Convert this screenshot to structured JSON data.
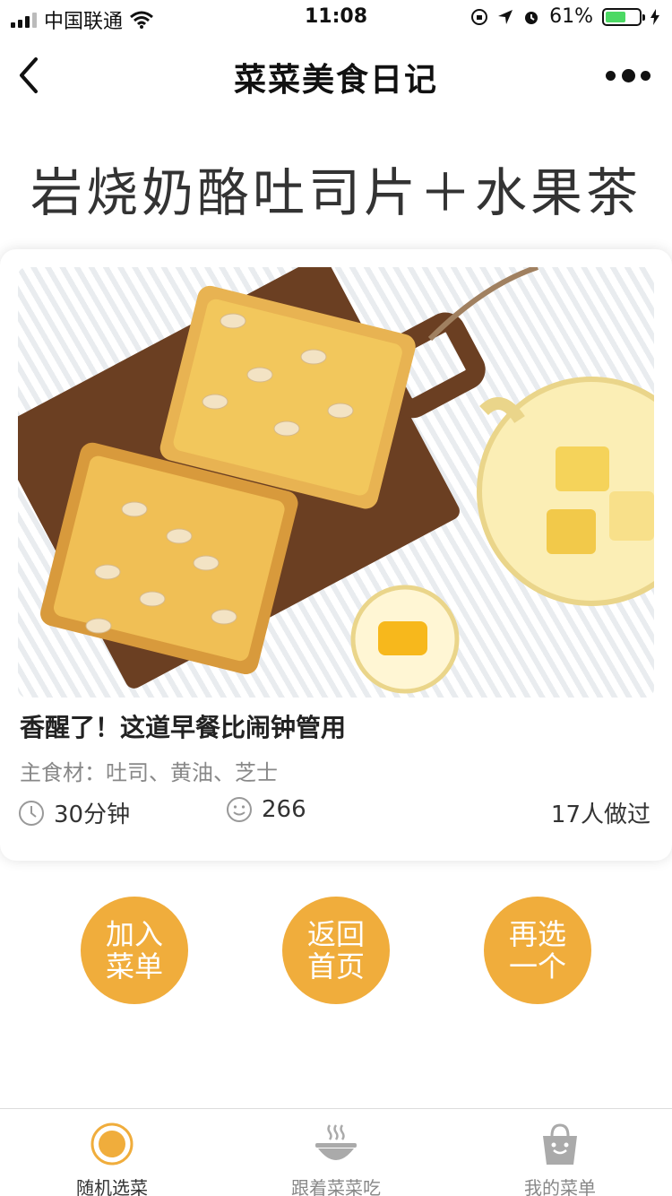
{
  "status_bar": {
    "carrier": "中国联通",
    "time": "11:08",
    "battery": "61%",
    "battery_level": 0.61
  },
  "nav": {
    "title": "菜菜美食日记"
  },
  "dish": {
    "title": "岩烧奶酪吐司片＋水果茶"
  },
  "card": {
    "headline": "香醒了！这道早餐比闹钟管用",
    "ingredients": "主食材：吐司、黄油、芝士",
    "time": "30分钟",
    "likes": "266",
    "made_count": "17人做过"
  },
  "actions": {
    "add_menu": "加入菜单",
    "back_home": "返回首页",
    "pick_again": "再选一个"
  },
  "tabs": [
    {
      "label": "随机选菜",
      "icon": "target-icon",
      "active": true
    },
    {
      "label": "跟着菜菜吃",
      "icon": "bowl-icon",
      "active": false
    },
    {
      "label": "我的菜单",
      "icon": "bag-icon",
      "active": false
    }
  ],
  "colors": {
    "accent": "#f0ad3c",
    "battery": "#4cd964"
  }
}
